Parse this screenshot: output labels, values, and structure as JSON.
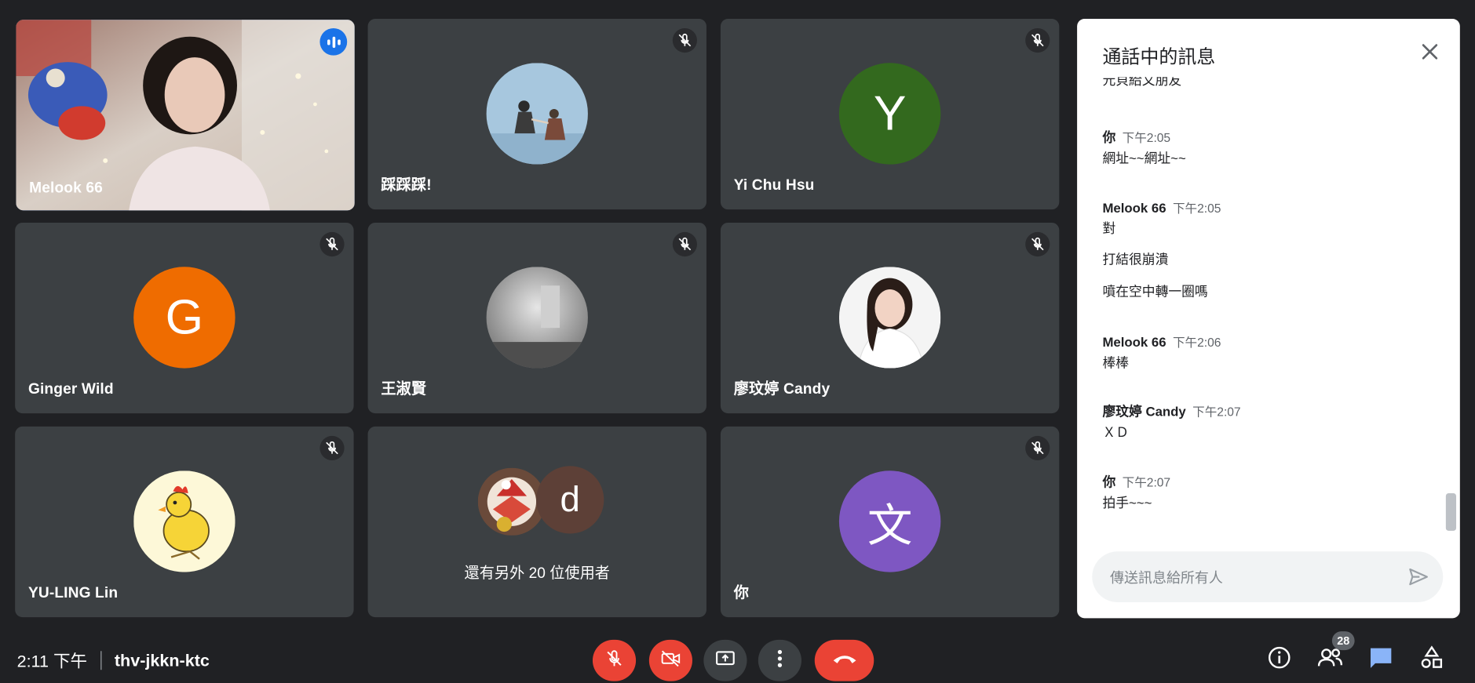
{
  "tiles": [
    {
      "name": "Melook 66",
      "kind": "video",
      "speaking": true
    },
    {
      "name": "踩踩踩!",
      "kind": "photo-avatar",
      "muted": true
    },
    {
      "name": "Yi Chu Hsu",
      "kind": "letter-avatar",
      "letter": "Y",
      "color": "#33691e",
      "muted": true
    },
    {
      "name": "Ginger Wild",
      "kind": "letter-avatar",
      "letter": "G",
      "color": "#ef6c00",
      "muted": true
    },
    {
      "name": "王淑賢",
      "kind": "photo-avatar",
      "muted": true
    },
    {
      "name": "廖玟婷 Candy",
      "kind": "photo-avatar",
      "muted": true
    },
    {
      "name": "YU-LING Lin",
      "kind": "photo-avatar",
      "muted": true
    },
    {
      "name": "還有另外 20 位使用者",
      "kind": "overflow",
      "letter": "d",
      "color": "#5d4037"
    },
    {
      "name": "你",
      "kind": "letter-avatar",
      "letter": "文",
      "color": "#7e57c2",
      "muted": true
    }
  ],
  "chat": {
    "title": "通話中的訊息",
    "cut_off_text": "元貝給又朋友",
    "messages": [
      {
        "sender": "你",
        "time": "下午2:05",
        "lines": [
          "網址~~網址~~"
        ]
      },
      {
        "sender": "Melook 66",
        "time": "下午2:05",
        "lines": [
          "對",
          "打結很崩潰",
          "噴在空中轉一圈嗎"
        ]
      },
      {
        "sender": "Melook 66",
        "time": "下午2:06",
        "lines": [
          "棒棒"
        ]
      },
      {
        "sender": "廖玟婷 Candy",
        "time": "下午2:07",
        "lines": [
          "ＸＤ"
        ]
      },
      {
        "sender": "你",
        "time": "下午2:07",
        "lines": [
          "拍手~~~"
        ]
      }
    ],
    "input_placeholder": "傳送訊息給所有人"
  },
  "bottom_bar": {
    "time": "2:11 下午",
    "meeting_code": "thv-jkkn-ktc",
    "people_count": "28"
  },
  "colors": {
    "background": "#202124",
    "tile": "#3c4043",
    "red": "#ea4335",
    "accent_blue": "#8ab4f8",
    "chat_icon_blue": "#8ab4f8"
  },
  "icons": {
    "mute": "mic-off-icon",
    "speaking": "audio-level-icon",
    "close": "close-icon",
    "send": "send-icon",
    "mic": "mic-off-icon",
    "camera": "camera-off-icon",
    "present": "present-screen-icon",
    "more": "more-vertical-icon",
    "hangup": "call-end-icon",
    "info": "info-icon",
    "people": "people-icon",
    "chat": "chat-icon",
    "activities": "activities-icon"
  }
}
